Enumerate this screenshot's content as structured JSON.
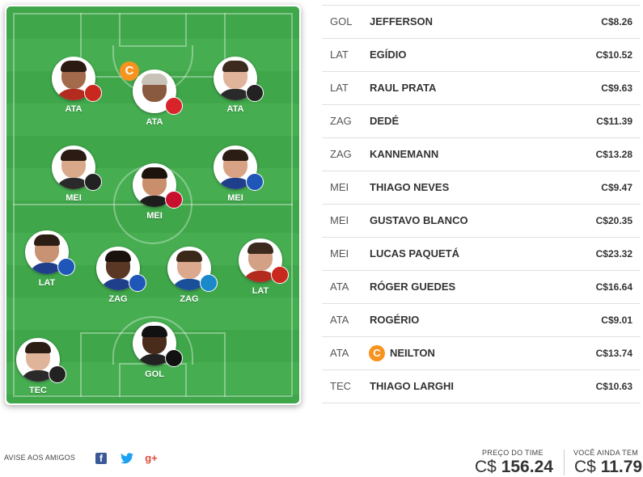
{
  "lineup": [
    {
      "id": "ata-left",
      "position": "ATA",
      "hair": "#2a1a12",
      "skin": "#a36a4b",
      "shirt": "#b22b1e",
      "badge": "sport-recife-crest-icon",
      "badge_color": "#c8281d"
    },
    {
      "id": "ata-center",
      "position": "ATA",
      "hair": "#c9c2b8",
      "skin": "#8a5a40",
      "shirt": "#ffffff",
      "badge": "vitoria-crest-icon",
      "badge_color": "#d8232a",
      "captain": "C"
    },
    {
      "id": "ata-right",
      "position": "ATA",
      "hair": "#3b2a1d",
      "skin": "#e0b49a",
      "shirt": "#2a2a2a",
      "badge": "atletico-mg-crest-icon",
      "badge_color": "#222222"
    },
    {
      "id": "mei-left",
      "position": "MEI",
      "hair": "#2b1b12",
      "skin": "#d9a98a",
      "shirt": "#2a2a2a",
      "badge": "atletico-mg-crest-icon",
      "badge_color": "#222222"
    },
    {
      "id": "mei-center",
      "position": "MEI",
      "hair": "#1d130d",
      "skin": "#c98f6c",
      "shirt": "#1d1d1d",
      "badge": "flamengo-crest-icon",
      "badge_color": "#c8102e"
    },
    {
      "id": "mei-right",
      "position": "MEI",
      "hair": "#2b1d14",
      "skin": "#d8a285",
      "shirt": "#1f3f8a",
      "badge": "cruzeiro-crest-icon",
      "badge_color": "#1f57b8"
    },
    {
      "id": "lat-left",
      "position": "LAT",
      "hair": "#2b1d14",
      "skin": "#c89373",
      "shirt": "#1f3f8a",
      "badge": "cruzeiro-crest-icon",
      "badge_color": "#1f57b8"
    },
    {
      "id": "zag-left",
      "position": "ZAG",
      "hair": "#1a120c",
      "skin": "#5a3624",
      "shirt": "#1f3f8a",
      "badge": "cruzeiro-crest-icon",
      "badge_color": "#1f57b8"
    },
    {
      "id": "zag-right",
      "position": "ZAG",
      "hair": "#3a2818",
      "skin": "#dba98d",
      "shirt": "#1a4f9a",
      "badge": "gremio-crest-icon",
      "badge_color": "#1b88c9"
    },
    {
      "id": "lat-right",
      "position": "LAT",
      "hair": "#3b2a1d",
      "skin": "#d3a186",
      "shirt": "#b22b1e",
      "badge": "sport-recife-crest-icon",
      "badge_color": "#c8281d"
    },
    {
      "id": "tec",
      "position": "TEC",
      "hair": "#2b1d14",
      "skin": "#e0b49a",
      "shirt": "#2a2a2a",
      "badge": "atletico-mg-crest-icon",
      "badge_color": "#222222"
    },
    {
      "id": "gol",
      "position": "GOL",
      "hair": "#111111",
      "skin": "#4a2c1c",
      "shirt": "#222222",
      "badge": "botafogo-crest-icon",
      "badge_color": "#111111"
    }
  ],
  "players": [
    {
      "pos": "GOL",
      "name": "JEFFERSON",
      "price": "C$8.26"
    },
    {
      "pos": "LAT",
      "name": "EGÍDIO",
      "price": "C$10.52"
    },
    {
      "pos": "LAT",
      "name": "RAUL PRATA",
      "price": "C$9.63"
    },
    {
      "pos": "ZAG",
      "name": "DEDÉ",
      "price": "C$11.39"
    },
    {
      "pos": "ZAG",
      "name": "KANNEMANN",
      "price": "C$13.28"
    },
    {
      "pos": "MEI",
      "name": "THIAGO NEVES",
      "price": "C$9.47"
    },
    {
      "pos": "MEI",
      "name": "GUSTAVO BLANCO",
      "price": "C$20.35"
    },
    {
      "pos": "MEI",
      "name": "LUCAS PAQUETÁ",
      "price": "C$23.32"
    },
    {
      "pos": "ATA",
      "name": "RÓGER GUEDES",
      "price": "C$16.64"
    },
    {
      "pos": "ATA",
      "name": "ROGÉRIO",
      "price": "C$9.01"
    },
    {
      "pos": "ATA",
      "name": "NEILTON",
      "price": "C$13.74",
      "captain": "C"
    },
    {
      "pos": "TEC",
      "name": "THIAGO LARGHI",
      "price": "C$10.63"
    }
  ],
  "footer": {
    "share_label": "AVISE AOS AMIGOS",
    "share_icons": [
      "facebook-icon",
      "twitter-icon",
      "google-plus-icon"
    ],
    "team_price_label": "PREÇO DO TIME",
    "team_price_currency": "C$",
    "team_price_value": "156.24",
    "remaining_label": "VOCÊ AINDA TEM",
    "remaining_currency": "C$",
    "remaining_value": "11.79"
  },
  "colors": {
    "captain": "#f7931e",
    "field_dark": "#3fa64a",
    "field_light": "#46ae51"
  }
}
